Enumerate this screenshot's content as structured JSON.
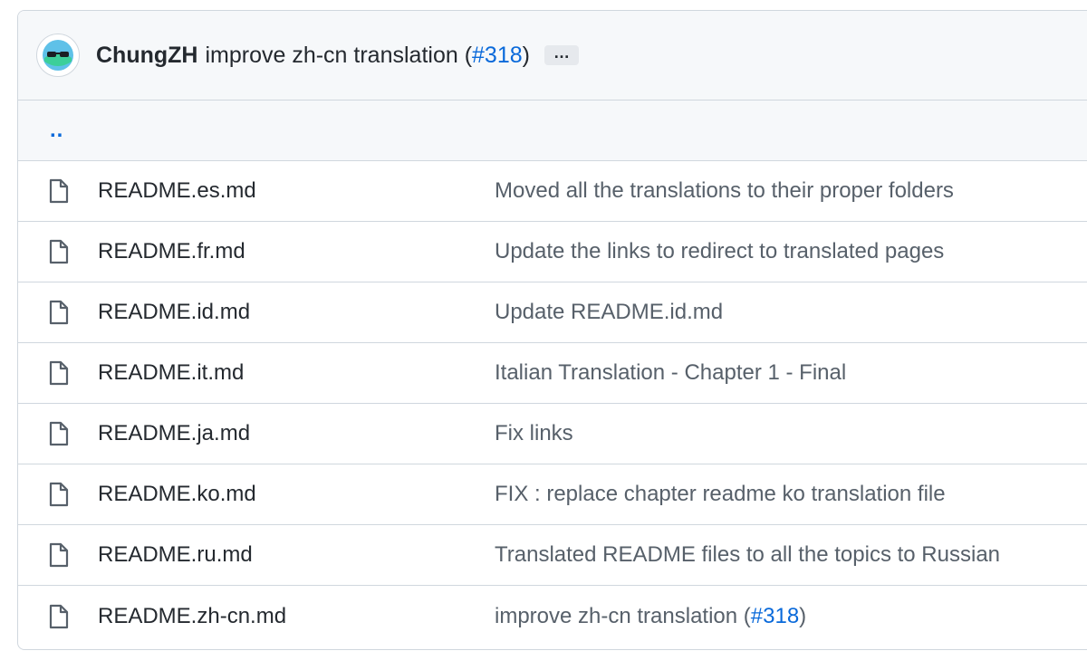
{
  "header": {
    "author": "ChungZH",
    "message_prefix": "improve zh-cn translation (",
    "pr_link": "#318",
    "message_suffix": ")",
    "more_label": "…"
  },
  "parent_dir": "..",
  "files": [
    {
      "name": "README.es.md",
      "commit": "Moved all the translations to their proper folders"
    },
    {
      "name": "README.fr.md",
      "commit": "Update the links to redirect to translated pages"
    },
    {
      "name": "README.id.md",
      "commit": "Update README.id.md"
    },
    {
      "name": "README.it.md",
      "commit": "Italian Translation - Chapter 1 - Final"
    },
    {
      "name": "README.ja.md",
      "commit": "Fix links"
    },
    {
      "name": "README.ko.md",
      "commit": "FIX : replace chapter readme ko translation file"
    },
    {
      "name": "README.ru.md",
      "commit": "Translated README files to all the topics to Russian"
    },
    {
      "name": "README.zh-cn.md",
      "commit_prefix": "improve zh-cn translation (",
      "commit_link": "#318",
      "commit_suffix": ")"
    }
  ],
  "icons": {
    "avatar": "avatar-icon",
    "file": "file-icon"
  },
  "colors": {
    "link": "#0969da",
    "header_bg": "#f6f8fa",
    "border": "#d0d7de",
    "muted_text": "#57606a"
  }
}
